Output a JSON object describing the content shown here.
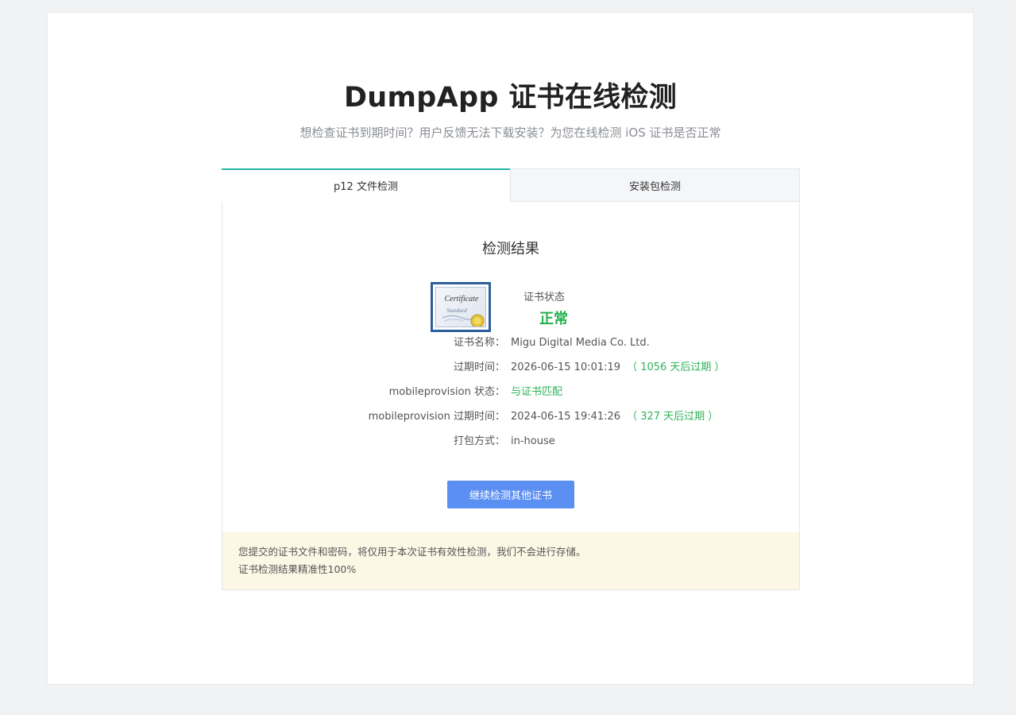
{
  "page": {
    "title": "DumpApp 证书在线检测",
    "subtitle": "想检查证书到期时间？用户反馈无法下载安装？为您在线检测 iOS 证书是否正常"
  },
  "tabs": [
    {
      "label": "p12 文件检测",
      "active": true
    },
    {
      "label": "安装包检测",
      "active": false
    }
  ],
  "result": {
    "heading": "检测结果",
    "cert_icon": "certificate-icon",
    "cert_icon_text": "Certificate",
    "cert_icon_subtext": "Standard",
    "status_label": "证书状态",
    "status_value": "正常",
    "rows": [
      {
        "label": "证书名称：",
        "value": "Migu Digital Media Co. Ltd.",
        "extra": ""
      },
      {
        "label": "过期时间：",
        "value": "2026-06-15 10:01:19",
        "extra": "（ 1056 天后过期 ）"
      },
      {
        "label": "mobileprovision 状态：",
        "value": "与证书匹配",
        "extra": ""
      },
      {
        "label": "mobileprovision 过期时间：",
        "value": "2024-06-15 19:41:26",
        "extra": "（ 327 天后过期 ）"
      },
      {
        "label": "打包方式：",
        "value": "in-house",
        "extra": ""
      }
    ],
    "continue_button": "继续检测其他证书"
  },
  "notice": {
    "line1": "您提交的证书文件和密码，将仅用于本次证书有效性检测，我们不会进行存储。",
    "line2": "证书检测结果精准性100%"
  },
  "colors": {
    "accent_tab": "#21b8a0",
    "status_ok": "#22b14c",
    "button": "#5b8ff2",
    "notice_bg": "#fdf8e6"
  }
}
